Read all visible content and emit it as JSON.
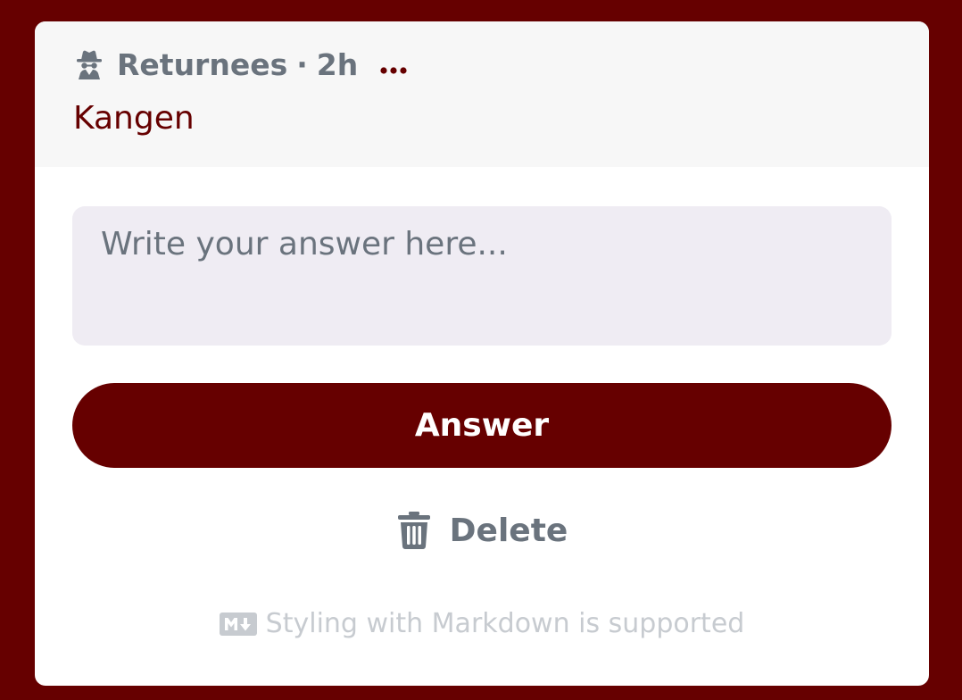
{
  "post": {
    "author_icon": "spy-icon",
    "author": "Returnees",
    "separator": "·",
    "time_ago": "2h",
    "more_icon": "ellipsis-icon",
    "title": "Kangen"
  },
  "answer_form": {
    "placeholder": "Write your answer here...",
    "value": "",
    "submit_label": "Answer",
    "delete_icon": "trash-icon",
    "delete_label": "Delete",
    "markdown_icon": "markdown-icon",
    "markdown_note": "Styling with Markdown is supported"
  },
  "colors": {
    "brand": "#660000",
    "muted": "#6a737d",
    "input_bg": "#efecf3",
    "header_bg": "#f7f7f7",
    "note": "#c7cbd0"
  }
}
